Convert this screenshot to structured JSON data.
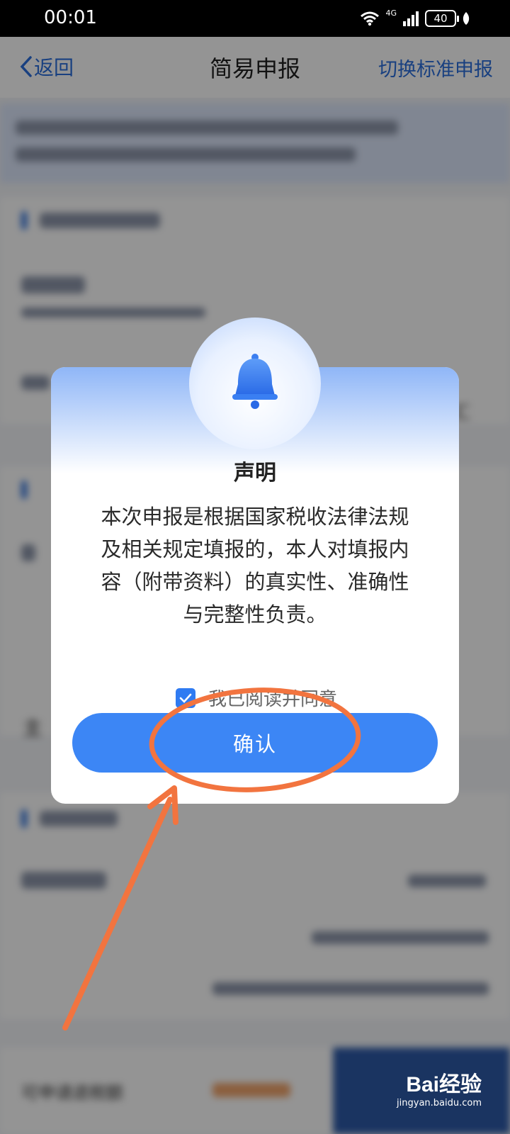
{
  "status_bar": {
    "time": "00:01",
    "network": "4G",
    "battery": "40"
  },
  "nav": {
    "back_label": "返回",
    "title": "简易申报",
    "action_label": "切换标准申报"
  },
  "background": {
    "main_tax_office_fragment": "主",
    "refund_label": "可申请退税额",
    "sidebar_fragment": "汇"
  },
  "dialog": {
    "title": "声明",
    "body_lines": [
      "本次申报是根据国家税收法律法规",
      "及相关规定填报的，本人对填报内",
      "容（附带资料）的真实性、准确性",
      "与完整性负责。"
    ],
    "agree_label": "我已阅读并同意",
    "agree_checked": true,
    "confirm_label": "确认",
    "accent_color": "#3c86f5"
  },
  "annotation": {
    "color": "#f2743f"
  },
  "watermark": {
    "logo": "Bai经验",
    "url": "jingyan.baidu.com"
  }
}
